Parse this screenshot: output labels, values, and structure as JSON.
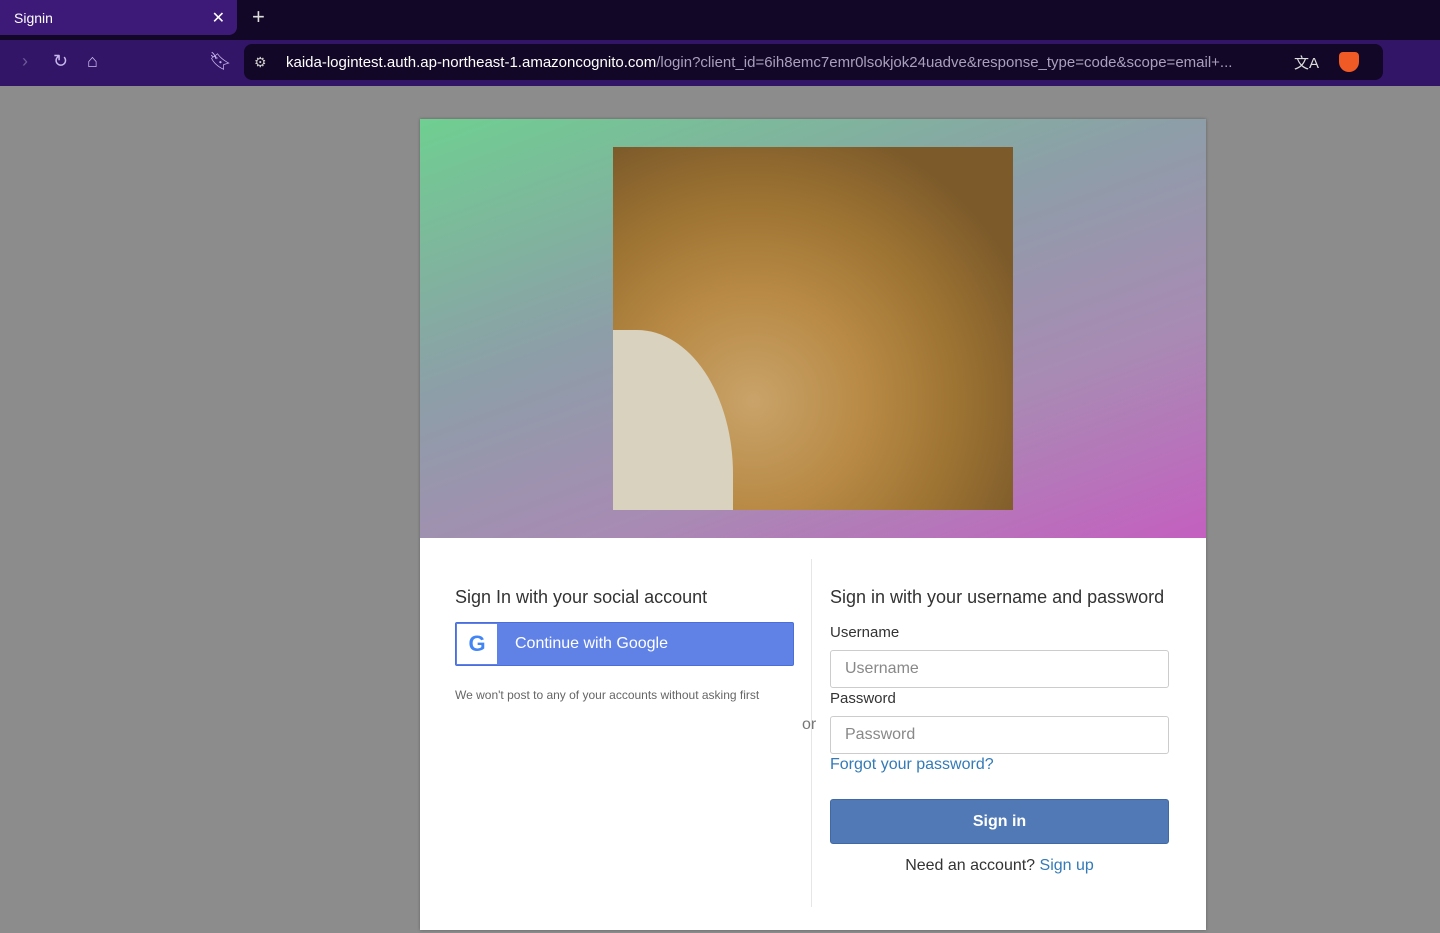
{
  "browser": {
    "tab_title": "Signin",
    "url_host": "kaida-logintest.auth.ap-northeast-1.amazoncognito.com",
    "url_path": "/login?client_id=6ih8emc7emr0lsokjok24uadve&response_type=code&scope=email+..."
  },
  "social": {
    "heading": "Sign In with your social account",
    "google_label": "Continue with Google",
    "note": "We won't post to any of your accounts without asking first"
  },
  "or": "or",
  "login": {
    "heading": "Sign in with your username and password",
    "username_label": "Username",
    "username_placeholder": "Username",
    "password_label": "Password",
    "password_placeholder": "Password",
    "forgot": "Forgot your password?",
    "signin": "Sign in",
    "need_account": "Need an account?",
    "signup": "Sign up"
  }
}
